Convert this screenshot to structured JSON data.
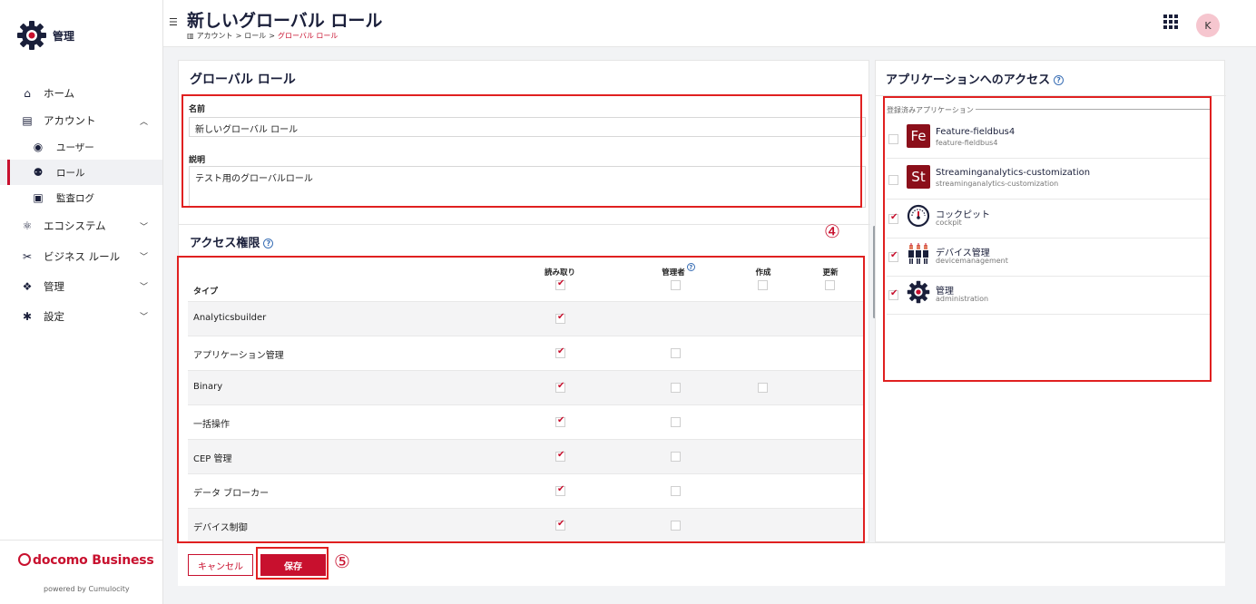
{
  "sidebar": {
    "brand_title": "管理",
    "items": [
      {
        "label": "ホーム"
      },
      {
        "label": "アカウント"
      },
      {
        "label": "ユーザー"
      },
      {
        "label": "ロール"
      },
      {
        "label": "監査ログ"
      },
      {
        "label": "エコシステム"
      },
      {
        "label": "ビジネス ルール"
      },
      {
        "label": "管理"
      },
      {
        "label": "設定"
      }
    ],
    "brand_logo_text": "docomo Business",
    "powered_by": "powered by Cumulocity"
  },
  "header": {
    "title": "新しいグローバル ロール",
    "breadcrumb": [
      "アカウント",
      ">",
      "ロール",
      ">",
      "グローバル ロール"
    ],
    "avatar_initial": "K"
  },
  "global_role": {
    "card_title": "グローバル ロール",
    "name_label": "名前",
    "name_value": "新しいグローバル ロール",
    "description_label": "説明",
    "description_value": "テスト用のグローバルロール"
  },
  "access": {
    "title": "アクセス権限",
    "type_header": "タイプ",
    "columns": [
      "読み取り",
      "管理者",
      "作成",
      "更新"
    ],
    "header_checks": [
      true,
      false,
      false,
      false
    ],
    "rows": [
      {
        "label": "Analyticsbuilder",
        "read": true,
        "admin": null,
        "create": null
      },
      {
        "label": "アプリケーション管理",
        "read": true,
        "admin": false,
        "create": null
      },
      {
        "label": "Binary",
        "read": true,
        "admin": false,
        "create": false
      },
      {
        "label": "一括操作",
        "read": true,
        "admin": false,
        "create": null
      },
      {
        "label": "CEP 管理",
        "read": true,
        "admin": false,
        "create": null
      },
      {
        "label": "データ ブローカー",
        "read": true,
        "admin": false,
        "create": null
      },
      {
        "label": "デバイス制御",
        "read": true,
        "admin": false,
        "create": null
      }
    ]
  },
  "footer": {
    "cancel_label": "キャンセル",
    "save_label": "保存"
  },
  "apps": {
    "title": "アプリケーションへのアクセス",
    "registered_label": "登録済みアプリケーション",
    "items": [
      {
        "name": "Feature-fieldbus4",
        "key": "feature-fieldbus4",
        "icon_text": "Fe",
        "checked": false
      },
      {
        "name": "Streaminganalytics-customization",
        "key": "streaminganalytics-customization",
        "icon_text": "St",
        "checked": false
      },
      {
        "name": "コックピット",
        "key": "cockpit",
        "icon": "gauge-icon",
        "checked": true
      },
      {
        "name": "デバイス管理",
        "key": "devicemanagement",
        "icon": "devices-icon",
        "checked": true
      },
      {
        "name": "管理",
        "key": "administration",
        "icon": "gear-icon",
        "checked": true
      }
    ]
  },
  "annotations": {
    "marker_4": "④",
    "marker_5": "⑤"
  },
  "colors": {
    "accent": "#c8102e",
    "navy": "#1a1f3a",
    "annotation": "#e02020"
  }
}
